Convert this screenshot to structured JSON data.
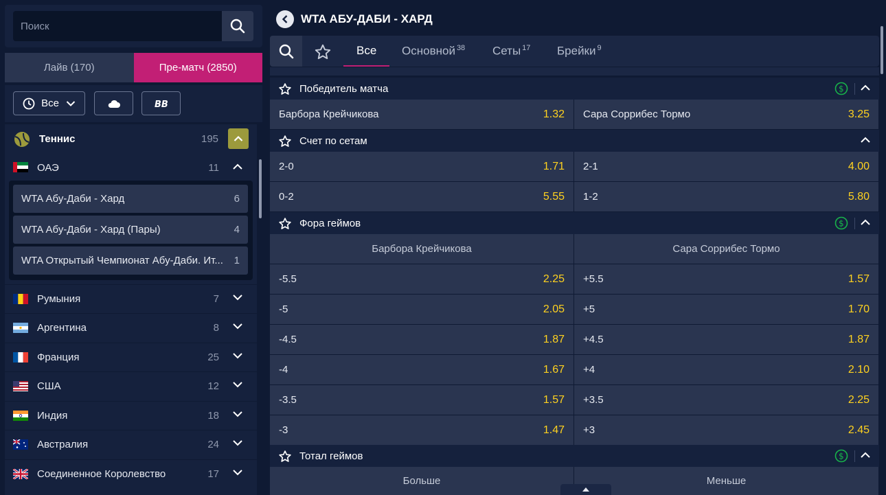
{
  "search": {
    "placeholder": "Поиск"
  },
  "modes": {
    "live": "Лайв (170)",
    "prematch": "Пре-матч (2850)"
  },
  "filters": {
    "all_label": "Все"
  },
  "sport": {
    "name": "Теннис",
    "count": "195"
  },
  "countries": [
    {
      "name": "ОАЭ",
      "count": "11"
    },
    {
      "name": "Румыния",
      "count": "7"
    },
    {
      "name": "Аргентина",
      "count": "8"
    },
    {
      "name": "Франция",
      "count": "25"
    },
    {
      "name": "США",
      "count": "12"
    },
    {
      "name": "Индия",
      "count": "18"
    },
    {
      "name": "Австралия",
      "count": "24"
    },
    {
      "name": "Соединенное Королевство",
      "count": "17"
    }
  ],
  "leagues": [
    {
      "name": "WTA Абу-Даби - Хард",
      "count": "6"
    },
    {
      "name": "WTA Абу-Даби - Хард (Пары)",
      "count": "4"
    },
    {
      "name": "WTA Открытый Чемпионат Абу-Даби. Ит...",
      "count": "1"
    }
  ],
  "header": {
    "title": "WTA АБУ-ДАБИ - ХАРД"
  },
  "tabs": [
    {
      "label": "Все",
      "count": ""
    },
    {
      "label": "Основной",
      "count": "38"
    },
    {
      "label": "Сеты",
      "count": "17"
    },
    {
      "label": "Брейки",
      "count": "9"
    }
  ],
  "markets": {
    "winner": {
      "title": "Победитель матча",
      "outcomes": [
        {
          "label": "Барбора Крейчикова",
          "odd": "1.32"
        },
        {
          "label": "Сара Соррибес Тормо",
          "odd": "3.25"
        }
      ]
    },
    "sets": {
      "title": "Счет по сетам",
      "outcomes": [
        {
          "label": "2-0",
          "odd": "1.71"
        },
        {
          "label": "2-1",
          "odd": "4.00"
        },
        {
          "label": "0-2",
          "odd": "5.55"
        },
        {
          "label": "1-2",
          "odd": "5.80"
        }
      ]
    },
    "handicap": {
      "title": "Фора геймов",
      "col1": "Барбора Крейчикова",
      "col2": "Сара Соррибес Тормо",
      "rows": [
        {
          "l1": "-5.5",
          "o1": "2.25",
          "l2": "+5.5",
          "o2": "1.57"
        },
        {
          "l1": "-5",
          "o1": "2.05",
          "l2": "+5",
          "o2": "1.70"
        },
        {
          "l1": "-4.5",
          "o1": "1.87",
          "l2": "+4.5",
          "o2": "1.87"
        },
        {
          "l1": "-4",
          "o1": "1.67",
          "l2": "+4",
          "o2": "2.10"
        },
        {
          "l1": "-3.5",
          "o1": "1.57",
          "l2": "+3.5",
          "o2": "2.25"
        },
        {
          "l1": "-3",
          "o1": "1.47",
          "l2": "+3",
          "o2": "2.45"
        }
      ]
    },
    "total": {
      "title": "Тотал геймов",
      "col1": "Больше",
      "col2": "Меньше"
    }
  },
  "colors": {
    "accent": "#c21f75",
    "odd": "#ffd21f",
    "sport_toggle": "#9c9a3c"
  }
}
